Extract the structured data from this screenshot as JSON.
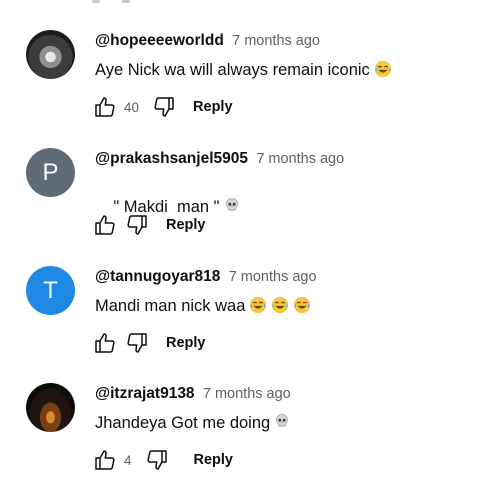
{
  "comments": [
    {
      "handle": "@hopeeeeworldd",
      "time": "7 months ago",
      "text": "Aye Nick wa will always remain iconic",
      "emojis": [
        "face-with-tears-of-joy-icon"
      ],
      "like_count": "40",
      "reply_label": "Reply",
      "avatar": "photo"
    },
    {
      "handle": "@prakashsanjel5905",
      "time": "7 months ago",
      "text": "\" Makdi  man \"",
      "emojis": [
        "skull-icon"
      ],
      "like_count": "",
      "reply_label": "Reply",
      "avatar_letter": "P",
      "avatar_color": "#5f6c78"
    },
    {
      "handle": "@tannugoyar818",
      "time": "7 months ago",
      "text": "Mandi man nick waa",
      "emojis": [
        "face-with-tears-of-joy-icon",
        "face-with-tears-of-joy-icon",
        "face-with-tears-of-joy-icon"
      ],
      "like_count": "",
      "reply_label": "Reply",
      "avatar_letter": "T",
      "avatar_color": "#1e88e5"
    },
    {
      "handle": "@itzrajat9138",
      "time": "7 months ago",
      "text": "Jhandeya Got me doing",
      "emojis": [
        "skull-icon"
      ],
      "like_count": "4",
      "reply_label": "Reply",
      "avatar": "photo"
    }
  ]
}
